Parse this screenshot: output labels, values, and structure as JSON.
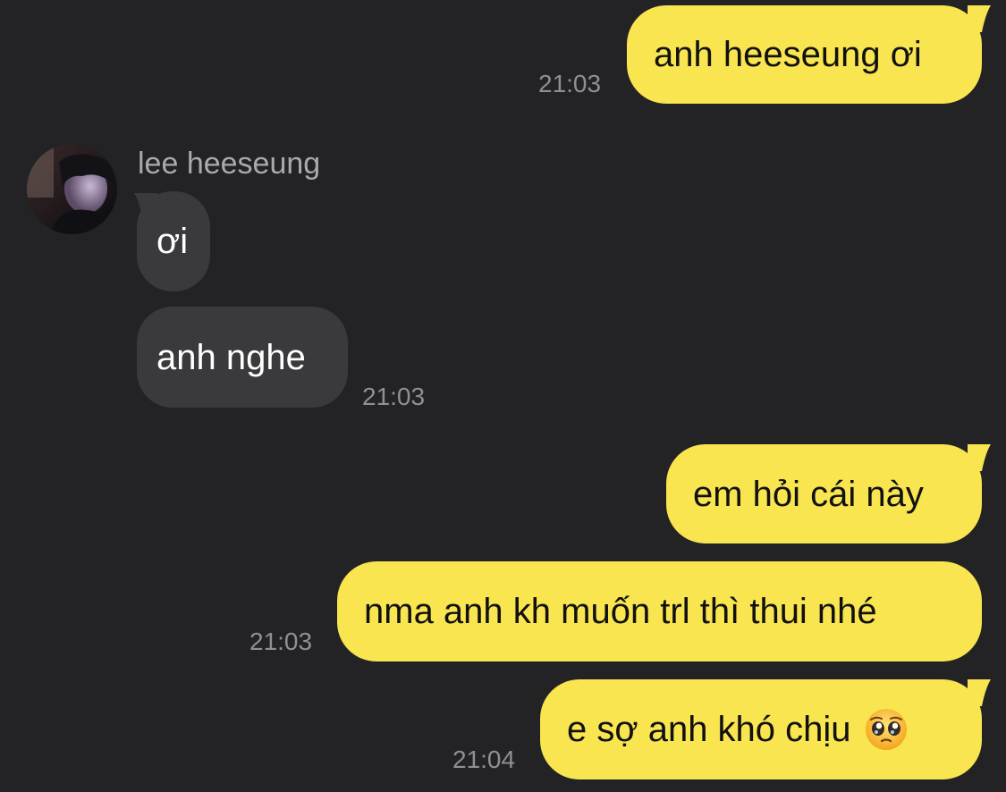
{
  "conversation": {
    "contact_name": "lee heeseung",
    "messages": [
      {
        "id": "m1",
        "direction": "outgoing",
        "text": "anh heeseung ơi",
        "time": "21:03"
      },
      {
        "id": "m2",
        "direction": "incoming",
        "text": "ơi"
      },
      {
        "id": "m3",
        "direction": "incoming",
        "text": "anh nghe",
        "time": "21:03"
      },
      {
        "id": "m4",
        "direction": "outgoing",
        "text": "em hỏi cái này"
      },
      {
        "id": "m5",
        "direction": "outgoing",
        "text": "nma anh kh muốn trl thì thui nhé",
        "time": "21:03"
      },
      {
        "id": "m6",
        "direction": "outgoing",
        "text": "e sợ anh khó chịu",
        "emoji": "pleading-face-icon",
        "time": "21:04"
      }
    ]
  },
  "colors": {
    "background": "#232326",
    "outgoing_bubble": "#f8e54f",
    "incoming_bubble": "#3a3a3d",
    "timestamp": "#8f8f94",
    "sender_name": "#a9a9ae"
  }
}
